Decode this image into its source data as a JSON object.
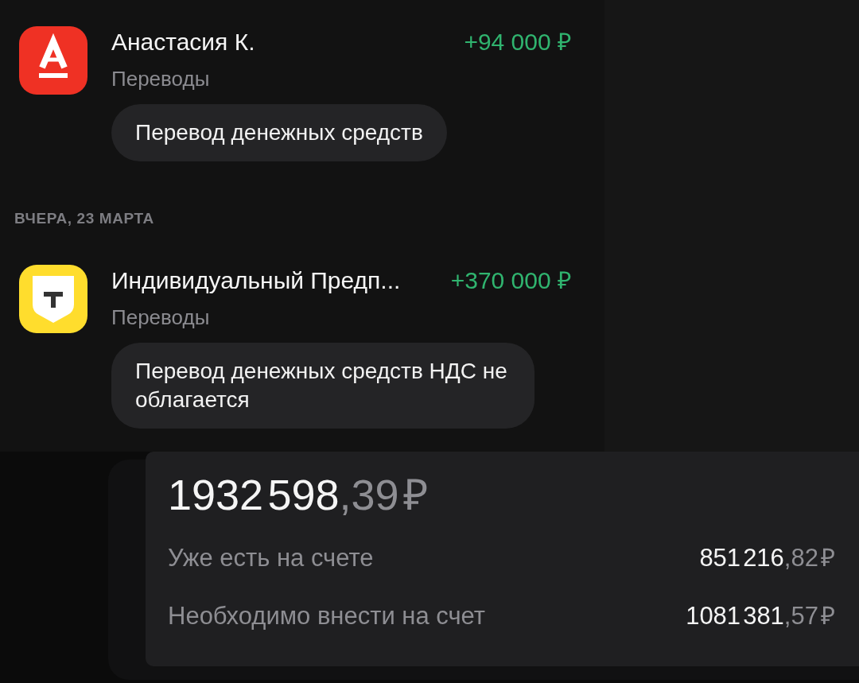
{
  "feed": [
    {
      "kind": "transaction",
      "logo": {
        "kind": "letter_tile"
      },
      "name": "Анастасия К.",
      "amount": "+94 000 ₽",
      "category": "Переводы",
      "comment": "Перевод денежных средств"
    },
    {
      "kind": "date",
      "label": "ВЧЕРА, 23 МАРТА"
    },
    {
      "kind": "transaction",
      "logo": {
        "kind": "shield_tile"
      },
      "name": "Индивидуальный Предп...",
      "amount": "+370 000 ₽",
      "category": "Переводы",
      "comment": "Перевод денежных средств НДС не облагается"
    }
  ],
  "summary": {
    "total": {
      "integer": "1932 598",
      "fraction": ",39 ₽"
    },
    "rows": [
      {
        "label": "Уже есть на счете",
        "integer": "851 216",
        "fraction": ",82 ₽"
      },
      {
        "label": "Необходимо внести на счет",
        "integer": "1081 381",
        "fraction": ",57 ₽"
      }
    ]
  }
}
